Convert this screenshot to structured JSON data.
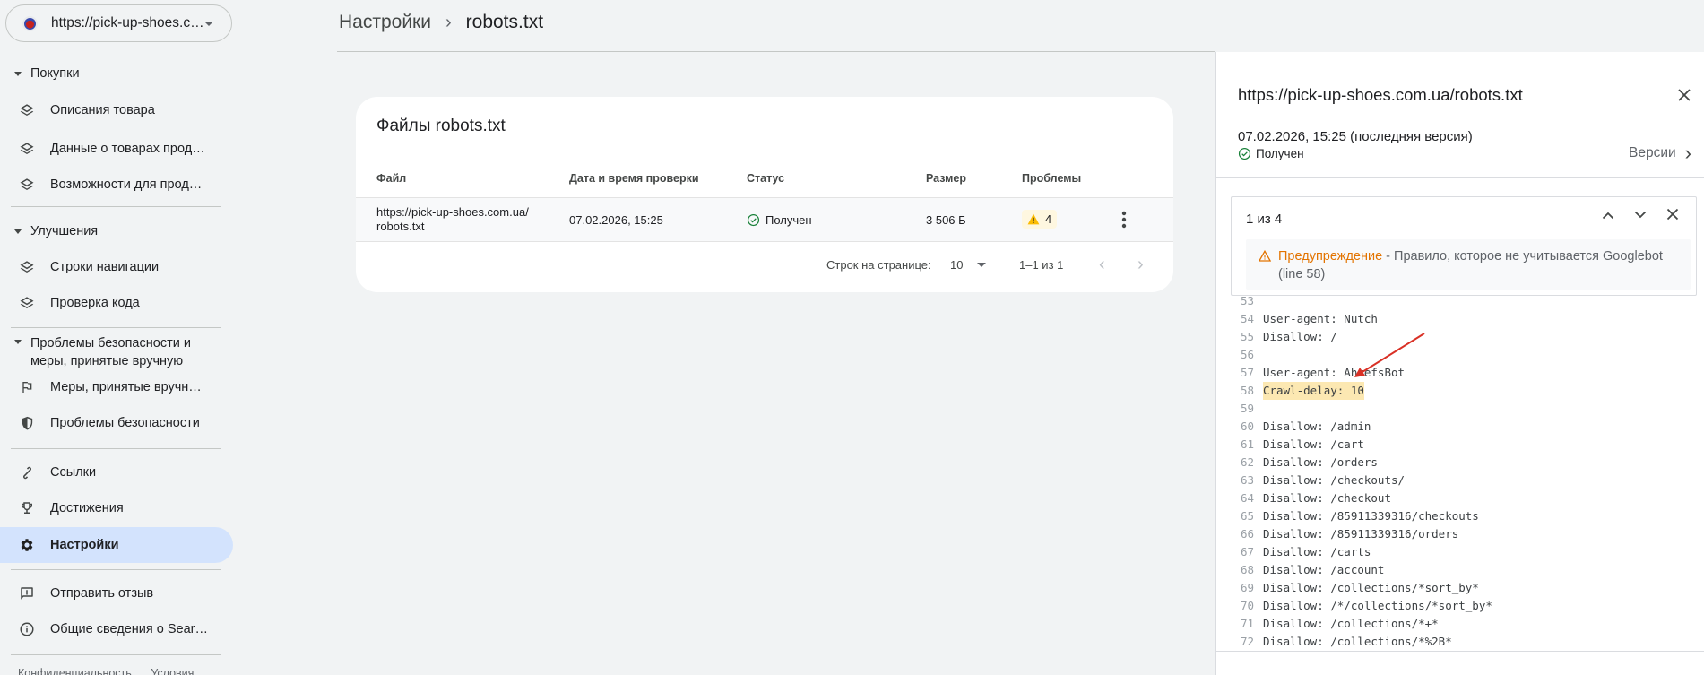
{
  "property": {
    "url": "https://pick-up-shoes.c…"
  },
  "sidebar": {
    "sections": [
      {
        "label": "Покупки"
      },
      {
        "label": "Улучшения"
      },
      {
        "label": "Проблемы безопасности и меры, принятые вручную"
      }
    ],
    "items": [
      {
        "label": "Описания товара",
        "icon": "layers-icon"
      },
      {
        "label": "Данные о товарах прод…",
        "icon": "layers-icon"
      },
      {
        "label": "Возможности для прод…",
        "icon": "layers-icon"
      },
      {
        "label": "Строки навигации",
        "icon": "layers-icon"
      },
      {
        "label": "Проверка кода",
        "icon": "layers-icon"
      },
      {
        "label": "Меры, принятые вручн…",
        "icon": "flag-icon"
      },
      {
        "label": "Проблемы безопасности",
        "icon": "shield-icon"
      },
      {
        "label": "Ссылки",
        "icon": "link-icon"
      },
      {
        "label": "Достижения",
        "icon": "trophy-icon"
      },
      {
        "label": "Настройки",
        "icon": "gear-icon"
      },
      {
        "label": "Отправить отзыв",
        "icon": "feedback-icon"
      },
      {
        "label": "Общие сведения о Sear…",
        "icon": "info-icon"
      }
    ],
    "footer": {
      "privacy": "Конфиденциальность",
      "terms": "Условия"
    }
  },
  "breadcrumb": {
    "parent": "Настройки",
    "current": "robots.txt"
  },
  "card": {
    "title": "Файлы robots.txt",
    "columns": {
      "file": "Файл",
      "date": "Дата и время проверки",
      "status": "Статус",
      "size": "Размер",
      "problems": "Проблемы"
    },
    "rows": [
      {
        "file": "https://pick-up-shoes.com.ua/robots.txt",
        "file_line1": "https://pick-up-shoes.com.ua/",
        "file_line2": "robots.txt",
        "date": "07.02.2026, 15:25",
        "status": "Получен",
        "size": "3 506 Б",
        "problems": "4"
      }
    ],
    "pager": {
      "rows_label": "Строк на странице:",
      "rows_value": "10",
      "range": "1–1 из 1"
    }
  },
  "panel": {
    "title": "https://pick-up-shoes.com.ua/robots.txt",
    "date": "07.02.2026, 15:25 (последняя версия)",
    "status": "Получен",
    "versions": "Версии",
    "issue": {
      "count": "1 из 4",
      "warning_label": "Предупреждение",
      "warning_text": " - Правило, которое не учитывается Googlebot (line 58)"
    },
    "code": [
      {
        "n": "53",
        "text": ""
      },
      {
        "n": "54",
        "text": "User-agent: Nutch"
      },
      {
        "n": "55",
        "text": "Disallow: /"
      },
      {
        "n": "56",
        "text": ""
      },
      {
        "n": "57",
        "text": "User-agent: AhrefsBot"
      },
      {
        "n": "58",
        "text": "Crawl-delay: 10"
      },
      {
        "n": "59",
        "text": ""
      },
      {
        "n": "60",
        "text": "Disallow: /admin"
      },
      {
        "n": "61",
        "text": "Disallow: /cart"
      },
      {
        "n": "62",
        "text": "Disallow: /orders"
      },
      {
        "n": "63",
        "text": "Disallow: /checkouts/"
      },
      {
        "n": "64",
        "text": "Disallow: /checkout"
      },
      {
        "n": "65",
        "text": "Disallow: /85911339316/checkouts"
      },
      {
        "n": "66",
        "text": "Disallow: /85911339316/orders"
      },
      {
        "n": "67",
        "text": "Disallow: /carts"
      },
      {
        "n": "68",
        "text": "Disallow: /account"
      },
      {
        "n": "69",
        "text": "Disallow: /collections/*sort_by*"
      },
      {
        "n": "70",
        "text": "Disallow: /*/collections/*sort_by*"
      },
      {
        "n": "71",
        "text": "Disallow: /collections/*+*"
      },
      {
        "n": "72",
        "text": "Disallow: /collections/*%2B*"
      }
    ]
  },
  "colors": {
    "accent": "#d3e3fd",
    "success": "#188038",
    "warning": "#e37400",
    "highlight": "#fce8b2",
    "arrow": "#d93025"
  }
}
